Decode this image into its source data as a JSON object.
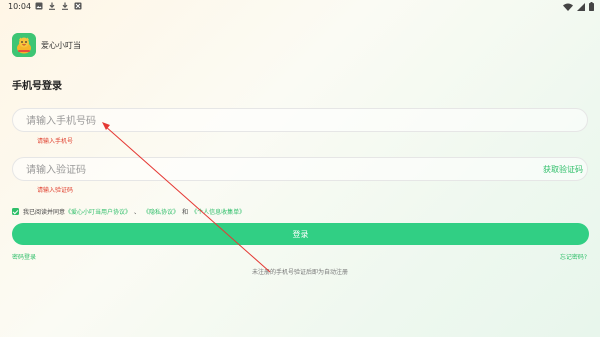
{
  "status_bar": {
    "time": "10:04"
  },
  "app": {
    "name": "爱心小叮当",
    "accent_color": "#31cf84"
  },
  "page": {
    "title": "手机号登录"
  },
  "phone_field": {
    "placeholder": "请输入手机号码",
    "error": "请输入手机号"
  },
  "code_field": {
    "placeholder": "请输入验证码",
    "get_code": "获取验证码",
    "error": "请输入验证码"
  },
  "agreement": {
    "checked": true,
    "prefix": "我已阅读并同意",
    "link1": "《爱心小叮当用户协议》",
    "sep1": "、",
    "link2": "《隐私协议》",
    "sep2": "和",
    "link3": "《个人信息收集单》"
  },
  "login_button": "登录",
  "password_login": "密码登录",
  "forgot_password": "忘记密码?",
  "note": "未注册的手机号验证后即为自动注册"
}
